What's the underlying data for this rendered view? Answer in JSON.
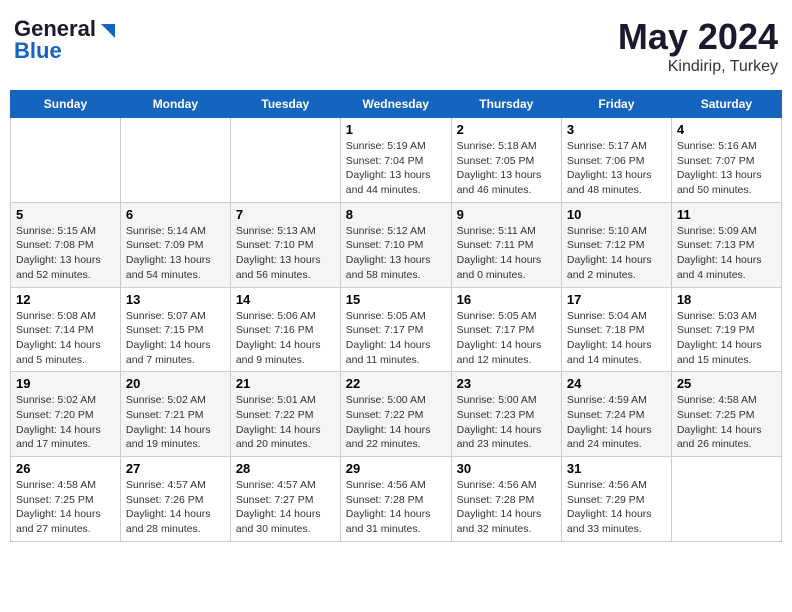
{
  "header": {
    "logo_line1": "General",
    "logo_line2": "Blue",
    "title": "May 2024",
    "location": "Kindirip, Turkey"
  },
  "days_of_week": [
    "Sunday",
    "Monday",
    "Tuesday",
    "Wednesday",
    "Thursday",
    "Friday",
    "Saturday"
  ],
  "weeks": [
    [
      {
        "day": "",
        "info": ""
      },
      {
        "day": "",
        "info": ""
      },
      {
        "day": "",
        "info": ""
      },
      {
        "day": "1",
        "info": "Sunrise: 5:19 AM\nSunset: 7:04 PM\nDaylight: 13 hours\nand 44 minutes."
      },
      {
        "day": "2",
        "info": "Sunrise: 5:18 AM\nSunset: 7:05 PM\nDaylight: 13 hours\nand 46 minutes."
      },
      {
        "day": "3",
        "info": "Sunrise: 5:17 AM\nSunset: 7:06 PM\nDaylight: 13 hours\nand 48 minutes."
      },
      {
        "day": "4",
        "info": "Sunrise: 5:16 AM\nSunset: 7:07 PM\nDaylight: 13 hours\nand 50 minutes."
      }
    ],
    [
      {
        "day": "5",
        "info": "Sunrise: 5:15 AM\nSunset: 7:08 PM\nDaylight: 13 hours\nand 52 minutes."
      },
      {
        "day": "6",
        "info": "Sunrise: 5:14 AM\nSunset: 7:09 PM\nDaylight: 13 hours\nand 54 minutes."
      },
      {
        "day": "7",
        "info": "Sunrise: 5:13 AM\nSunset: 7:10 PM\nDaylight: 13 hours\nand 56 minutes."
      },
      {
        "day": "8",
        "info": "Sunrise: 5:12 AM\nSunset: 7:10 PM\nDaylight: 13 hours\nand 58 minutes."
      },
      {
        "day": "9",
        "info": "Sunrise: 5:11 AM\nSunset: 7:11 PM\nDaylight: 14 hours\nand 0 minutes."
      },
      {
        "day": "10",
        "info": "Sunrise: 5:10 AM\nSunset: 7:12 PM\nDaylight: 14 hours\nand 2 minutes."
      },
      {
        "day": "11",
        "info": "Sunrise: 5:09 AM\nSunset: 7:13 PM\nDaylight: 14 hours\nand 4 minutes."
      }
    ],
    [
      {
        "day": "12",
        "info": "Sunrise: 5:08 AM\nSunset: 7:14 PM\nDaylight: 14 hours\nand 5 minutes."
      },
      {
        "day": "13",
        "info": "Sunrise: 5:07 AM\nSunset: 7:15 PM\nDaylight: 14 hours\nand 7 minutes."
      },
      {
        "day": "14",
        "info": "Sunrise: 5:06 AM\nSunset: 7:16 PM\nDaylight: 14 hours\nand 9 minutes."
      },
      {
        "day": "15",
        "info": "Sunrise: 5:05 AM\nSunset: 7:17 PM\nDaylight: 14 hours\nand 11 minutes."
      },
      {
        "day": "16",
        "info": "Sunrise: 5:05 AM\nSunset: 7:17 PM\nDaylight: 14 hours\nand 12 minutes."
      },
      {
        "day": "17",
        "info": "Sunrise: 5:04 AM\nSunset: 7:18 PM\nDaylight: 14 hours\nand 14 minutes."
      },
      {
        "day": "18",
        "info": "Sunrise: 5:03 AM\nSunset: 7:19 PM\nDaylight: 14 hours\nand 15 minutes."
      }
    ],
    [
      {
        "day": "19",
        "info": "Sunrise: 5:02 AM\nSunset: 7:20 PM\nDaylight: 14 hours\nand 17 minutes."
      },
      {
        "day": "20",
        "info": "Sunrise: 5:02 AM\nSunset: 7:21 PM\nDaylight: 14 hours\nand 19 minutes."
      },
      {
        "day": "21",
        "info": "Sunrise: 5:01 AM\nSunset: 7:22 PM\nDaylight: 14 hours\nand 20 minutes."
      },
      {
        "day": "22",
        "info": "Sunrise: 5:00 AM\nSunset: 7:22 PM\nDaylight: 14 hours\nand 22 minutes."
      },
      {
        "day": "23",
        "info": "Sunrise: 5:00 AM\nSunset: 7:23 PM\nDaylight: 14 hours\nand 23 minutes."
      },
      {
        "day": "24",
        "info": "Sunrise: 4:59 AM\nSunset: 7:24 PM\nDaylight: 14 hours\nand 24 minutes."
      },
      {
        "day": "25",
        "info": "Sunrise: 4:58 AM\nSunset: 7:25 PM\nDaylight: 14 hours\nand 26 minutes."
      }
    ],
    [
      {
        "day": "26",
        "info": "Sunrise: 4:58 AM\nSunset: 7:25 PM\nDaylight: 14 hours\nand 27 minutes."
      },
      {
        "day": "27",
        "info": "Sunrise: 4:57 AM\nSunset: 7:26 PM\nDaylight: 14 hours\nand 28 minutes."
      },
      {
        "day": "28",
        "info": "Sunrise: 4:57 AM\nSunset: 7:27 PM\nDaylight: 14 hours\nand 30 minutes."
      },
      {
        "day": "29",
        "info": "Sunrise: 4:56 AM\nSunset: 7:28 PM\nDaylight: 14 hours\nand 31 minutes."
      },
      {
        "day": "30",
        "info": "Sunrise: 4:56 AM\nSunset: 7:28 PM\nDaylight: 14 hours\nand 32 minutes."
      },
      {
        "day": "31",
        "info": "Sunrise: 4:56 AM\nSunset: 7:29 PM\nDaylight: 14 hours\nand 33 minutes."
      },
      {
        "day": "",
        "info": ""
      }
    ]
  ]
}
